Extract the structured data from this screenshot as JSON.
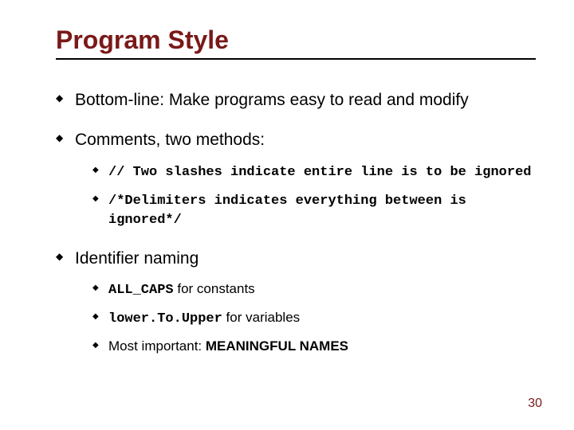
{
  "title": "Program Style",
  "bullets": {
    "b1": "Bottom-line: Make programs easy to read and modify",
    "b2": "Comments, two methods:",
    "b2_sub": {
      "a": "// Two slashes indicate entire line is to be ignored",
      "b": "/*Delimiters indicates everything between is ignored*/"
    },
    "b3": "Identifier naming",
    "b3_sub": {
      "a_code": "ALL_CAPS",
      "a_rest": " for constants",
      "b_code": "lower.To.Upper",
      "b_rest": " for variables",
      "c_pre": "Most important: ",
      "c_bold": "MEANINGFUL NAMES"
    }
  },
  "page_number": "30"
}
